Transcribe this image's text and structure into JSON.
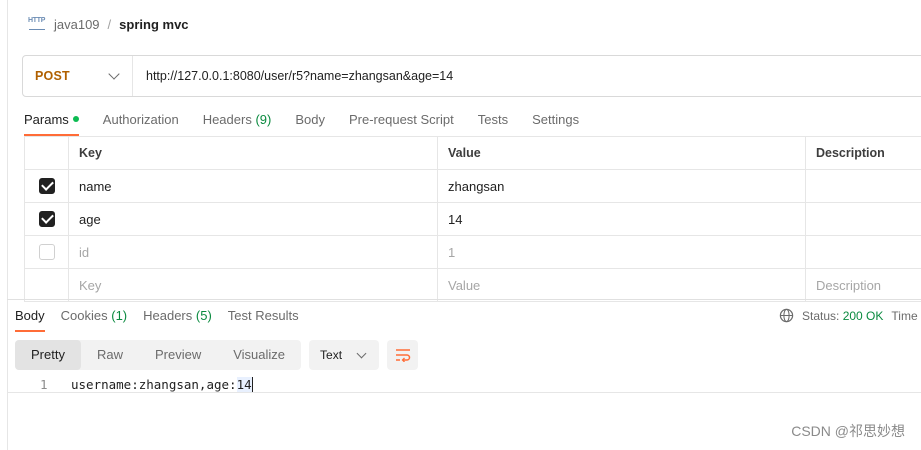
{
  "breadcrumb": {
    "icon": "http-icon",
    "icon_text": "HTTP",
    "parent": "java109",
    "separator": "/",
    "current": "spring mvc"
  },
  "request": {
    "method": "POST",
    "url": "http://127.0.0.1:8080/user/r5?name=zhangsan&age=14"
  },
  "request_tabs": [
    {
      "label": "Params"
    },
    {
      "label": "Authorization"
    },
    {
      "label": "Headers",
      "count": "(9)"
    },
    {
      "label": "Body"
    },
    {
      "label": "Pre-request Script"
    },
    {
      "label": "Tests"
    },
    {
      "label": "Settings"
    }
  ],
  "params": {
    "headers": {
      "key": "Key",
      "value": "Value",
      "description": "Description"
    },
    "rows": [
      {
        "checked": true,
        "key": "name",
        "value": "zhangsan",
        "description": ""
      },
      {
        "checked": true,
        "key": "age",
        "value": "14",
        "description": ""
      },
      {
        "checked": false,
        "key": "id",
        "value": "1",
        "description": ""
      }
    ],
    "placeholder": {
      "key": "Key",
      "value": "Value",
      "description": "Description"
    }
  },
  "response_tabs": [
    {
      "label": "Body"
    },
    {
      "label": "Cookies",
      "count": "(1)"
    },
    {
      "label": "Headers",
      "count": "(5)"
    },
    {
      "label": "Test Results"
    }
  ],
  "status": {
    "label": "Status:",
    "code": "200 OK",
    "time_label": "Time"
  },
  "view_modes": [
    "Pretty",
    "Raw",
    "Preview",
    "Visualize"
  ],
  "format": "Text",
  "response_body": {
    "line_number": "1",
    "text_before_cursor": "username:zhangsan,age:",
    "text_at_cursor": "14"
  },
  "watermark": "CSDN @祁思妙想",
  "colors": {
    "accent": "#ff6c37",
    "method": "#b06000",
    "success": "#0a8a3f",
    "dot": "#0cbb52"
  }
}
